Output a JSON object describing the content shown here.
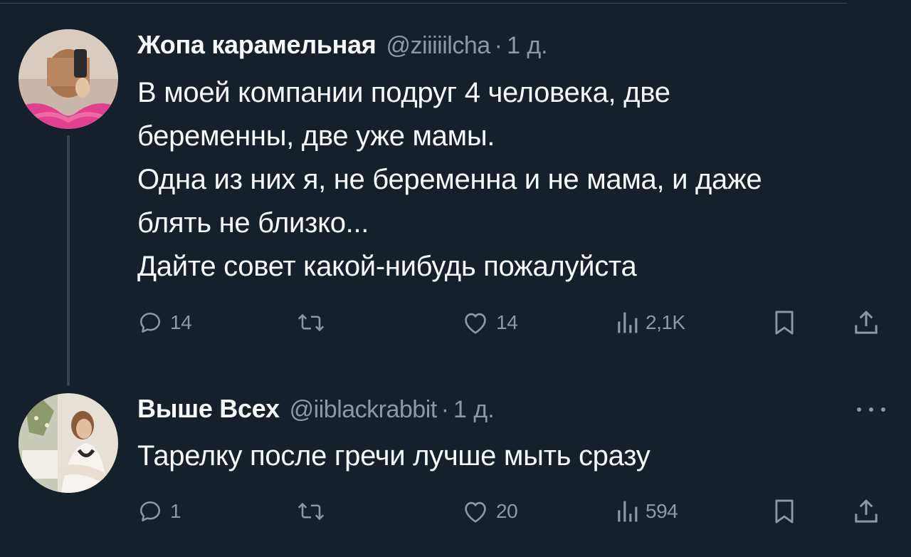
{
  "tweets": [
    {
      "display_name": "Жопа карамельная",
      "handle": "@ziiiiilcha",
      "separator": "·",
      "time": "1 д.",
      "text_lines": [
        "В моей компании подруг 4 человека, две",
        "беременны, две уже мамы.",
        "Одна из них я, не беременна и не мама, и даже",
        "блять не близко...",
        "Дайте совет какой-нибудь пожалуйста"
      ],
      "replies": "14",
      "likes": "14",
      "views": "2,1K"
    },
    {
      "display_name": "Выше Всех",
      "handle": "@iiblackrabbit",
      "separator": "·",
      "time": "1 д.",
      "text_lines": [
        "Тарелку после гречи лучше мыть сразу"
      ],
      "replies": "1",
      "likes": "20",
      "views": "594"
    }
  ],
  "icons": {
    "reply": "reply-icon",
    "retweet": "retweet-icon",
    "like": "heart-icon",
    "views": "views-icon",
    "bookmark": "bookmark-icon",
    "share": "share-icon",
    "more": "more-icon"
  },
  "colors": {
    "background": "#15202b",
    "primary_text": "#f7f9f9",
    "secondary_text": "#8b98a5",
    "divider": "#38444d"
  }
}
